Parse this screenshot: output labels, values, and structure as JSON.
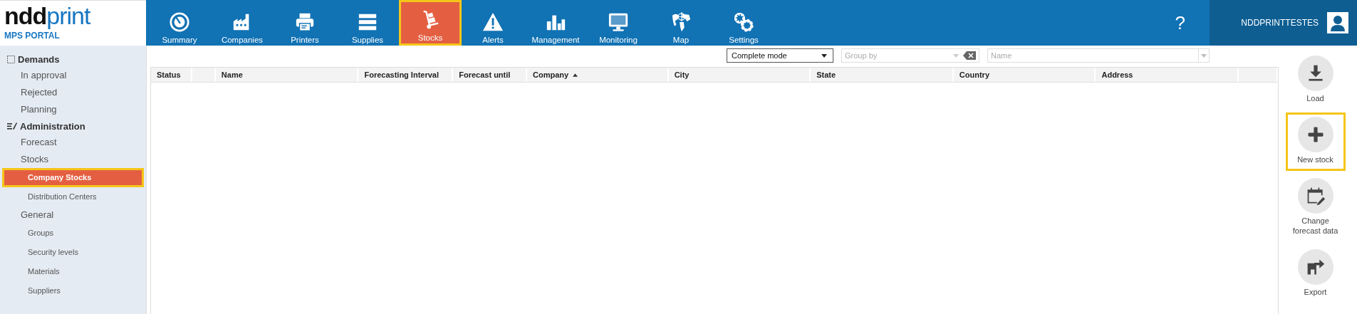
{
  "logo": {
    "brand_dark": "ndd",
    "brand_light": "print",
    "subtitle": "MPS PORTAL"
  },
  "nav": [
    {
      "label": "Summary",
      "kind": "gauge",
      "selected": false,
      "highlighted": false
    },
    {
      "label": "Companies",
      "kind": "factory",
      "selected": false,
      "highlighted": false
    },
    {
      "label": "Printers",
      "kind": "printer",
      "selected": false,
      "highlighted": false
    },
    {
      "label": "Supplies",
      "kind": "stack",
      "selected": false,
      "highlighted": false
    },
    {
      "label": "Stocks",
      "kind": "trolley",
      "selected": true,
      "highlighted": true
    },
    {
      "label": "Alerts",
      "kind": "warning",
      "selected": false,
      "highlighted": false
    },
    {
      "label": "Management",
      "kind": "bars",
      "selected": false,
      "highlighted": false
    },
    {
      "label": "Monitoring",
      "kind": "monitor",
      "selected": false,
      "highlighted": false
    },
    {
      "label": "Map",
      "kind": "globe",
      "selected": false,
      "highlighted": false
    },
    {
      "label": "Settings",
      "kind": "gears",
      "selected": false,
      "highlighted": false
    }
  ],
  "help": "?",
  "user": {
    "name": "NDDPRINTTESTES"
  },
  "sidebar": [
    {
      "label": "Demands",
      "kind": "checkbox",
      "children": [
        {
          "label": "In approval",
          "selected": false,
          "highlighted": false
        },
        {
          "label": "Rejected",
          "selected": false,
          "highlighted": false
        },
        {
          "label": "Planning",
          "selected": false,
          "highlighted": false
        }
      ]
    },
    {
      "label": "Administration",
      "kind": "edit",
      "children": [
        {
          "label": "Forecast",
          "selected": false,
          "highlighted": false
        },
        {
          "label": "Stocks",
          "selected": false,
          "highlighted": false,
          "children": [
            {
              "label": "Company Stocks",
              "selected": true,
              "highlighted": true
            },
            {
              "label": "Distribution Centers",
              "selected": false,
              "highlighted": false
            }
          ]
        },
        {
          "label": "General",
          "selected": false,
          "highlighted": false,
          "children": [
            {
              "label": "Groups",
              "selected": false,
              "highlighted": false
            },
            {
              "label": "Security levels",
              "selected": false,
              "highlighted": false
            },
            {
              "label": "Materials",
              "selected": false,
              "highlighted": false
            },
            {
              "label": "Suppliers",
              "selected": false,
              "highlighted": false
            }
          ]
        }
      ]
    }
  ],
  "toolbar": {
    "mode": {
      "value": "Complete mode"
    },
    "group_by": {
      "placeholder": "Group by"
    },
    "name_filter": {
      "placeholder": "Name"
    }
  },
  "table": {
    "columns": [
      {
        "label": "Status",
        "sorted": false
      },
      {
        "sorted": false
      },
      {
        "label": "Name",
        "sorted": false
      },
      {
        "label": "Forecasting Interval",
        "sorted": false
      },
      {
        "label": "Forecast until",
        "sorted": false
      },
      {
        "label": "Company",
        "sorted": true
      },
      {
        "label": "City",
        "sorted": false
      },
      {
        "label": "State",
        "sorted": false
      },
      {
        "label": "Country",
        "sorted": false
      },
      {
        "label": "Address",
        "sorted": false
      },
      {
        "sorted": false
      }
    ]
  },
  "actions": [
    {
      "label": "Load",
      "kind": "download",
      "highlighted": false
    },
    {
      "label": "New stock",
      "kind": "plus",
      "highlighted": true
    },
    {
      "label": "Change forecast data",
      "kind": "calendar",
      "highlighted": false
    },
    {
      "label": "Export",
      "kind": "export",
      "highlighted": false
    }
  ]
}
